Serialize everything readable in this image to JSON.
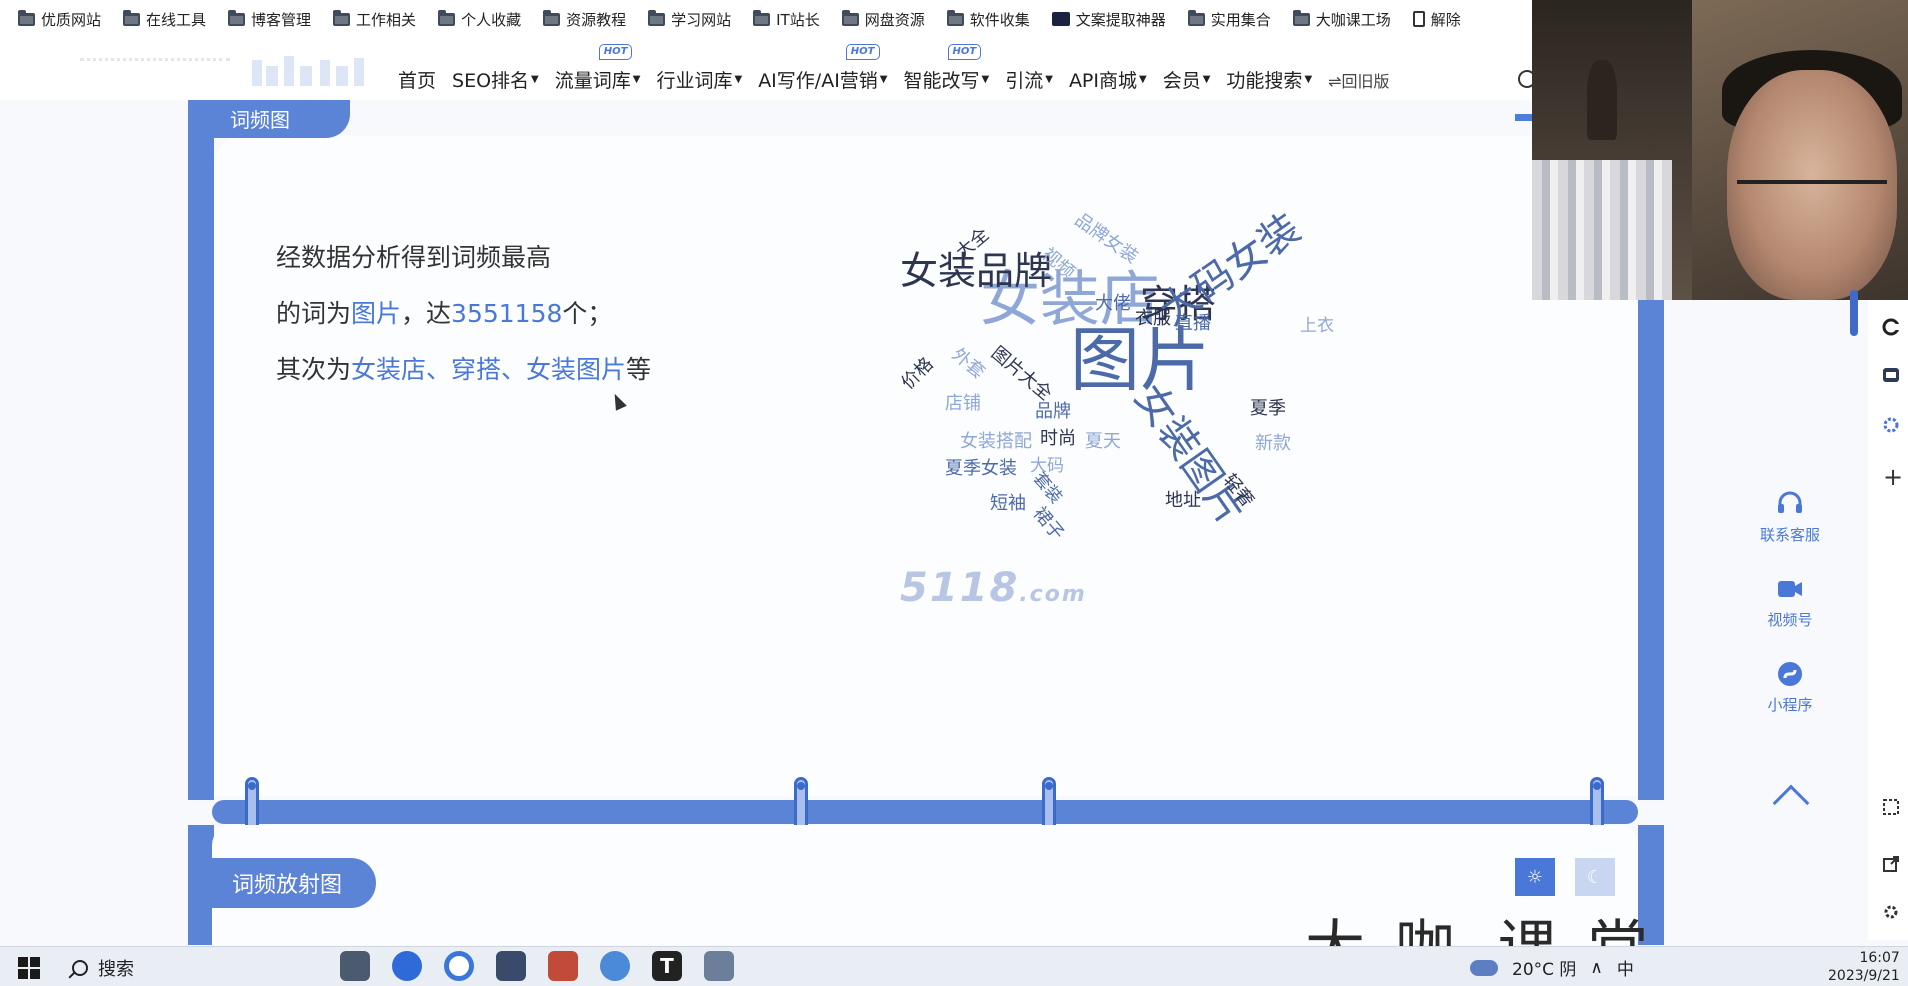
{
  "bookmarks": [
    {
      "label": "优质网站",
      "icon": "folder-icon"
    },
    {
      "label": "在线工具",
      "icon": "folder-icon"
    },
    {
      "label": "博客管理",
      "icon": "folder-icon"
    },
    {
      "label": "工作相关",
      "icon": "folder-icon"
    },
    {
      "label": "个人收藏",
      "icon": "folder-icon"
    },
    {
      "label": "资源教程",
      "icon": "folder-icon"
    },
    {
      "label": "学习网站",
      "icon": "folder-icon"
    },
    {
      "label": "IT站长",
      "icon": "folder-icon"
    },
    {
      "label": "网盘资源",
      "icon": "folder-icon"
    },
    {
      "label": "软件收集",
      "icon": "folder-icon"
    },
    {
      "label": "文案提取神器",
      "icon": "tv-icon"
    },
    {
      "label": "实用集合",
      "icon": "folder-icon"
    },
    {
      "label": "大咖课工场",
      "icon": "folder-icon"
    },
    {
      "label": "解除",
      "icon": "document-icon"
    }
  ],
  "nav": {
    "items": [
      {
        "label": "首页",
        "dropdown": false,
        "hot": false
      },
      {
        "label": "SEO排名",
        "dropdown": true,
        "hot": false
      },
      {
        "label": "流量词库",
        "dropdown": true,
        "hot": true
      },
      {
        "label": "行业词库",
        "dropdown": true,
        "hot": false
      },
      {
        "label": "AI写作/AI营销",
        "dropdown": true,
        "hot": true
      },
      {
        "label": "智能改写",
        "dropdown": true,
        "hot": true
      },
      {
        "label": "引流",
        "dropdown": true,
        "hot": false
      },
      {
        "label": "API商城",
        "dropdown": true,
        "hot": false
      },
      {
        "label": "会员",
        "dropdown": true,
        "hot": false
      },
      {
        "label": "功能搜索",
        "dropdown": true,
        "hot": false
      }
    ],
    "hot_badge": "HOT",
    "back_old": "⇌回旧版"
  },
  "section_top": {
    "tab_label": "词频图"
  },
  "summary": {
    "line1": "经数据分析得到词频最高",
    "line2_prefix": "的词为",
    "top_word": "图片",
    "line2_mid": "，达",
    "top_count": "3551158",
    "line2_suffix": "个；",
    "line3_prefix": "其次为",
    "next_words": "女装店、穿搭、女装图片",
    "line3_suffix": "等"
  },
  "word_cloud": [
    {
      "text": "女装店",
      "tone": "light",
      "size": 60
    },
    {
      "text": "图片",
      "tone": "mid",
      "size": 70
    },
    {
      "text": "女装品牌",
      "tone": "dark",
      "size": 38
    },
    {
      "text": "穿搭",
      "tone": "dark",
      "size": 38
    },
    {
      "text": "大码女装",
      "tone": "mid",
      "size": 40
    },
    {
      "text": "女装图片",
      "tone": "mid",
      "size": 40
    },
    {
      "text": "品牌女装",
      "tone": "light",
      "size": 18
    },
    {
      "text": "大全",
      "tone": "dark",
      "size": 18
    },
    {
      "text": "视频",
      "tone": "light",
      "size": 18
    },
    {
      "text": "大佬",
      "tone": "mid",
      "size": 18
    },
    {
      "text": "衣服",
      "tone": "dark",
      "size": 18
    },
    {
      "text": "直播",
      "tone": "mid",
      "size": 18
    },
    {
      "text": "上衣",
      "tone": "light",
      "size": 17
    },
    {
      "text": "价格",
      "tone": "dark",
      "size": 18
    },
    {
      "text": "外套",
      "tone": "light",
      "size": 18
    },
    {
      "text": "图片大全",
      "tone": "dark",
      "size": 18
    },
    {
      "text": "店铺",
      "tone": "light",
      "size": 18
    },
    {
      "text": "品牌",
      "tone": "mid",
      "size": 18
    },
    {
      "text": "夏季",
      "tone": "dark",
      "size": 18
    },
    {
      "text": "女装搭配",
      "tone": "light",
      "size": 18
    },
    {
      "text": "时尚",
      "tone": "dark",
      "size": 18
    },
    {
      "text": "夏天",
      "tone": "light",
      "size": 18
    },
    {
      "text": "新款",
      "tone": "light",
      "size": 18
    },
    {
      "text": "夏季女装",
      "tone": "mid",
      "size": 18
    },
    {
      "text": "大码",
      "tone": "light",
      "size": 17
    },
    {
      "text": "套装",
      "tone": "mid",
      "size": 17
    },
    {
      "text": "短袖",
      "tone": "mid",
      "size": 18
    },
    {
      "text": "裙子",
      "tone": "mid",
      "size": 18
    },
    {
      "text": "地址",
      "tone": "dark",
      "size": 18
    },
    {
      "text": "轻奢",
      "tone": "dark",
      "size": 18
    }
  ],
  "watermark": {
    "brand": "5118",
    "domain": ".com"
  },
  "section_bottom": {
    "tab_label": "词频放射图"
  },
  "sidebar": [
    {
      "label": "联系客服",
      "icon": "headset-icon"
    },
    {
      "label": "视频号",
      "icon": "video-channel-icon"
    },
    {
      "label": "小程序",
      "icon": "mini-program-icon"
    }
  ],
  "overlay_brand": {
    "left": "大咖",
    "dot": "·",
    "right": "课堂"
  },
  "taskbar": {
    "search_label": "搜索",
    "weather": "20°C 阴",
    "ime": "中",
    "time": "16:07",
    "date": "2023/9/21"
  },
  "colors": {
    "accent": "#5b84d6",
    "highlight": "#4a78d8"
  }
}
